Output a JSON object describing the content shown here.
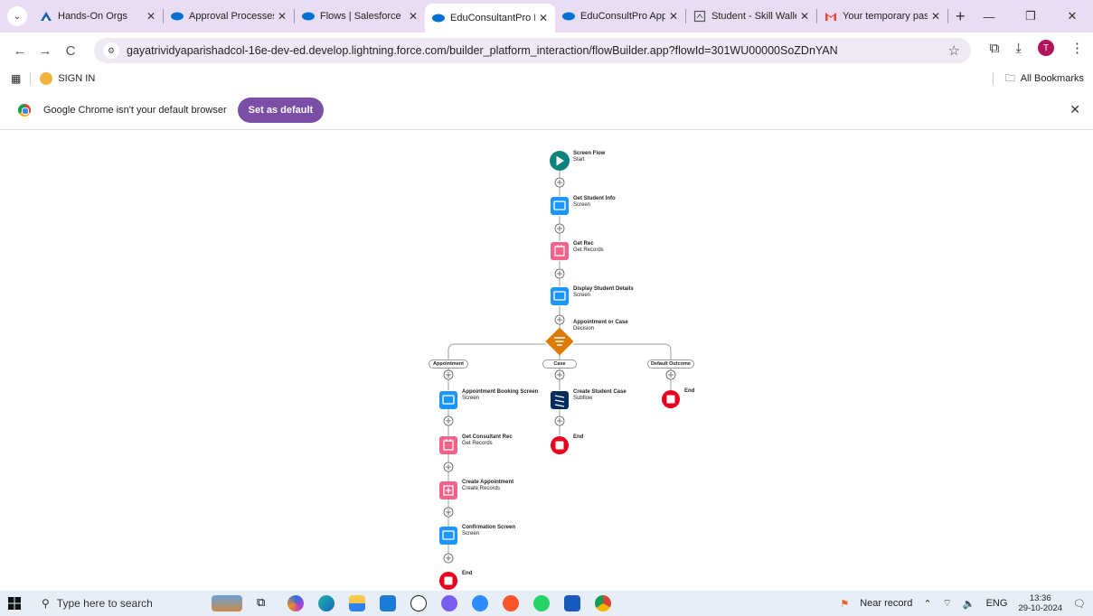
{
  "browser": {
    "tabs": [
      {
        "label": "Hands-On Orgs",
        "icon": "trailhead-icon",
        "active": false
      },
      {
        "label": "Approval Processes |",
        "icon": "salesforce-cloud-icon",
        "active": false
      },
      {
        "label": "Flows | Salesforce",
        "icon": "salesforce-cloud-icon",
        "active": false
      },
      {
        "label": "EduConsultantPro Ev",
        "icon": "salesforce-cloud-icon",
        "active": true
      },
      {
        "label": "EduConsultPro Appr",
        "icon": "salesforce-cloud-icon",
        "active": false
      },
      {
        "label": "Student - Skill Wallet",
        "icon": "document-icon",
        "active": false
      },
      {
        "label": "Your temporary pass",
        "icon": "gmail-icon",
        "active": false
      }
    ],
    "new_tab": "+",
    "url": "gayatrividyaparishadcol-16e-dev-ed.develop.lightning.force.com/builder_platform_interaction/flowBuilder.app?flowId=301WU00000SoZDnYAN",
    "avatar_letter": "T",
    "bookmarks": [
      {
        "label": "SIGN IN"
      }
    ],
    "all_bookmarks": "All Bookmarks",
    "infobar": {
      "message": "Google Chrome isn't your default browser",
      "button": "Set as default"
    }
  },
  "flow": {
    "nodes": [
      {
        "title": "Screen Flow",
        "subtitle": "Start"
      },
      {
        "title": "Get Student Info",
        "subtitle": "Screen"
      },
      {
        "title": "Get Rec",
        "subtitle": "Get Records"
      },
      {
        "title": "Display Student Details",
        "subtitle": "Screen"
      },
      {
        "title": "Appointment or Case",
        "subtitle": "Decision"
      },
      {
        "title": "Appointment Booking Screen",
        "subtitle": "Screen"
      },
      {
        "title": "Get Consultant Rec",
        "subtitle": "Get Records"
      },
      {
        "title": "Create Appointment",
        "subtitle": "Create Records"
      },
      {
        "title": "Confirmation Screen",
        "subtitle": "Screen"
      },
      {
        "title": "End",
        "subtitle": ""
      },
      {
        "title": "Create Student Case",
        "subtitle": "Subflow"
      },
      {
        "title": "End",
        "subtitle": ""
      },
      {
        "title": "End",
        "subtitle": ""
      }
    ],
    "branches": [
      "Appointment",
      "Case",
      "Default Outcome"
    ],
    "colors": {
      "start": "#0b827c",
      "screen": "#1b96ff",
      "records": "#f3628b",
      "decision": "#dd7a01",
      "subflow": "#032d60",
      "end": "#ea001e"
    }
  },
  "taskbar": {
    "search_placeholder": "Type here to search",
    "weather": "Near record",
    "lang": "ENG",
    "time": "13:36",
    "date": "29-10-2024"
  }
}
